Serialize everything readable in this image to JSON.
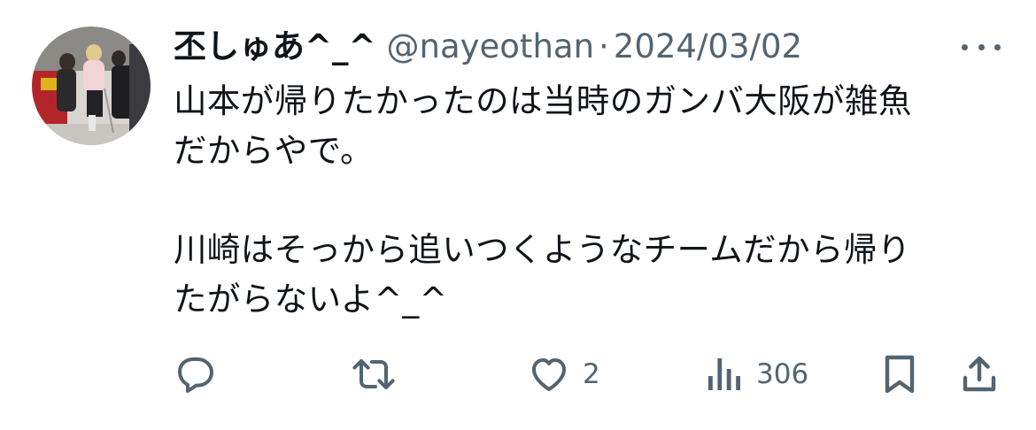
{
  "tweet": {
    "display_name": "丕しゅあ^_^",
    "handle": "@nayeothan",
    "separator": "·",
    "date": "2024/03/02",
    "body_lines": [
      "山本が帰りたかったのは当時のガンバ大阪が雑魚",
      "だからやで。",
      "",
      "川崎はそっから追いつくようなチームだから帰り",
      "たがらないよ^_^"
    ]
  },
  "actions": {
    "reply_icon": "reply-icon",
    "retweet_icon": "retweet-icon",
    "like_icon": "heart-icon",
    "like_count": "2",
    "views_icon": "views-icon",
    "views_count": "306",
    "bookmark_icon": "bookmark-icon",
    "share_icon": "share-icon"
  },
  "colors": {
    "text_primary": "#0f1419",
    "text_secondary": "#536471",
    "background": "#ffffff"
  }
}
